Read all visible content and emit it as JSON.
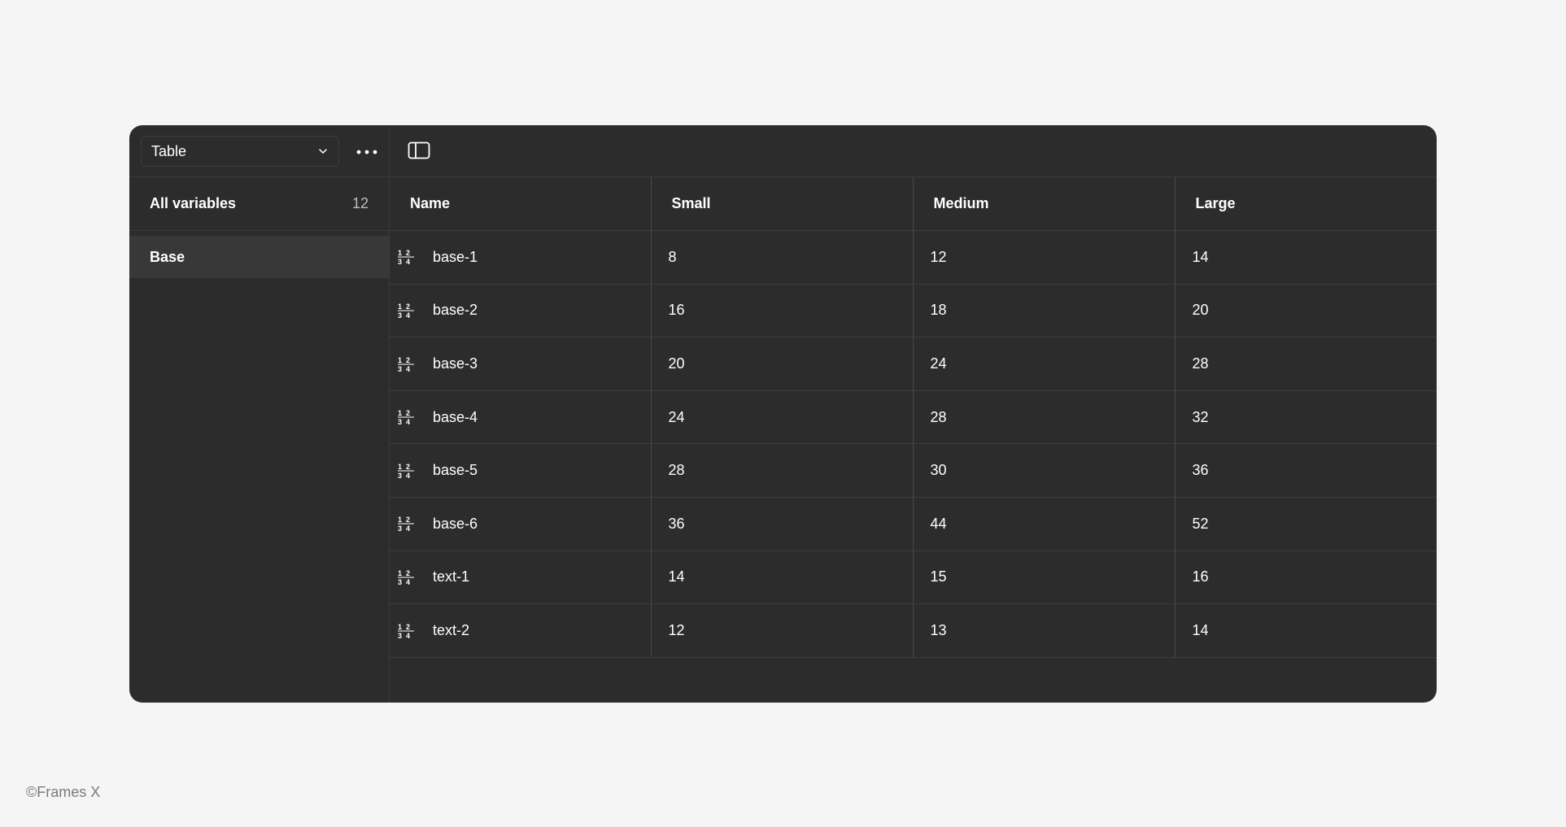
{
  "mode_select": {
    "value": "Table"
  },
  "sidebar": {
    "all_variables_label": "All variables",
    "all_variables_count": "12",
    "groups": [
      {
        "label": "Base"
      }
    ]
  },
  "table": {
    "headers": [
      "Name",
      "Small",
      "Medium",
      "Large"
    ],
    "rows": [
      {
        "name": "base-1",
        "small": "8",
        "medium": "12",
        "large": "14"
      },
      {
        "name": "base-2",
        "small": "16",
        "medium": "18",
        "large": "20"
      },
      {
        "name": "base-3",
        "small": "20",
        "medium": "24",
        "large": "28"
      },
      {
        "name": "base-4",
        "small": "24",
        "medium": "28",
        "large": "32"
      },
      {
        "name": "base-5",
        "small": "28",
        "medium": "30",
        "large": "36"
      },
      {
        "name": "base-6",
        "small": "36",
        "medium": "44",
        "large": "52"
      },
      {
        "name": "text-1",
        "small": "14",
        "medium": "15",
        "large": "16"
      },
      {
        "name": "text-2",
        "small": "12",
        "medium": "13",
        "large": "14"
      }
    ]
  },
  "icons": {
    "mode_chevron": "chevron-down-icon",
    "more": "more-horizontal-icon",
    "sidebar_toggle": "sidebar-toggle-icon",
    "variable_type": "number-variable-icon"
  },
  "colors": {
    "page_background": "#f5f5f5",
    "panel_background": "#2c2c2c",
    "selected_row": "#383838",
    "text": "#ffffff"
  },
  "footer": {
    "credit": "©Frames X"
  }
}
